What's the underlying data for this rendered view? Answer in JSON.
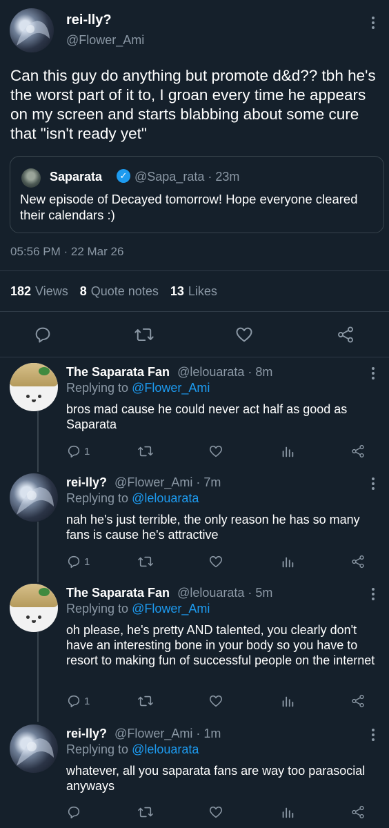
{
  "main": {
    "name": "rei-lly?",
    "handle": "@Flower_Ami",
    "text": "Can this guy do anything but promote d&d?? tbh he's the worst part of it to, I groan every time he appears on my screen and starts blabbing about some cure that \"isn't ready yet\"",
    "quote": {
      "name": "Saparata",
      "handle_time": "@Sapa_rata · 23m",
      "text": "New episode of Decayed tomorrow! Hope everyone cleared their calendars :)"
    },
    "timestamp": "05:56 PM · 22 Mar 26",
    "stats": {
      "views_num": "182",
      "views_label": "Views",
      "quotes_num": "8",
      "quotes_label": "Quote notes",
      "likes_num": "13",
      "likes_label": "Likes"
    }
  },
  "replies": [
    {
      "name": "The Saparata Fan",
      "meta": "@lelouarata · 8m",
      "replying_prefix": "Replying to",
      "replying_to": "@Flower_Ami",
      "text": "bros mad cause he could never act half as good as Saparata",
      "reply_count": "1"
    },
    {
      "name": "rei-lly?",
      "meta": "@Flower_Ami · 7m",
      "replying_prefix": "Replying to",
      "replying_to": "@lelouarata",
      "text": "nah he's just terrible, the only reason he has so many fans is cause he's attractive",
      "reply_count": "1"
    },
    {
      "name": "The Saparata Fan",
      "meta": "@lelouarata · 5m",
      "replying_prefix": "Replying to",
      "replying_to": "@Flower_Ami",
      "text": "oh please, he's pretty AND talented, you clearly don't have an interesting bone in your body so you have to resort to making fun of successful people on the internet",
      "reply_count": "1"
    },
    {
      "name": "rei-lly?",
      "meta": "@Flower_Ami · 1m",
      "replying_prefix": "Replying to",
      "replying_to": "@lelouarata",
      "text": "whatever, all you saparata fans are way too parasocial anyways",
      "reply_count": ""
    }
  ],
  "colors": {
    "background": "#15202b",
    "accent": "#1d9bf0",
    "muted": "#8b98a5"
  },
  "icons": [
    "reply-icon",
    "retweet-icon",
    "like-icon",
    "views-icon",
    "share-icon",
    "more-icon",
    "verified-icon"
  ]
}
